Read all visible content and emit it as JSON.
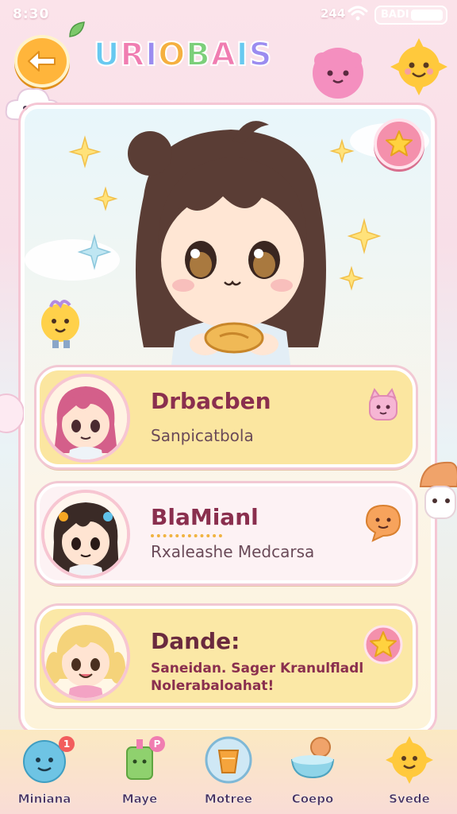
{
  "status_bar": {
    "time": "8:30",
    "network": "244",
    "battery_label": "BADI"
  },
  "header": {
    "title_letters": [
      "U",
      "R",
      "I",
      "O",
      "B",
      "A",
      "I",
      "S"
    ]
  },
  "hero": {
    "character": "girl-with-cookie"
  },
  "characters": [
    {
      "name": "Drbacben",
      "subtitle": "Sanpicatbola",
      "badge_icon": "pink-cat-icon"
    },
    {
      "name": "BlaMianl",
      "subtitle": "Rxaleashe Medcarsa",
      "badge_icon": "speech-bubble-icon"
    },
    {
      "name": "Dande:",
      "subtitle_line1": "Saneidan. Sager Kranulfladl",
      "subtitle_line2": "Nolerabaloahat!",
      "badge_icon": "star-icon"
    }
  ],
  "nav": [
    {
      "label": "Miniana",
      "icon": "smiley-bubble-icon",
      "badge": "1"
    },
    {
      "label": "Maye",
      "icon": "green-cup-icon",
      "badge": "P"
    },
    {
      "label": "Motree",
      "icon": "orange-drink-icon"
    },
    {
      "label": "Coepo",
      "icon": "food-bowl-icon"
    },
    {
      "label": "Svede",
      "icon": "sun-face-icon"
    }
  ],
  "colors": {
    "accent_pink": "#f490ac",
    "accent_orange": "#ffb53b",
    "name_text": "#8a2f4e"
  }
}
